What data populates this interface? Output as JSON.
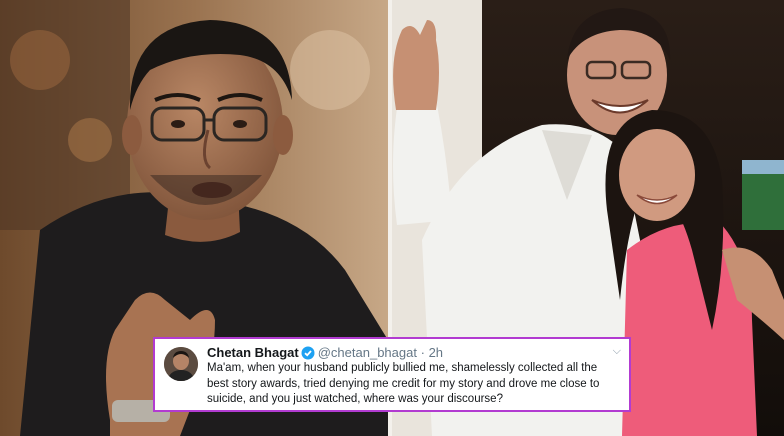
{
  "tweet": {
    "author_name": "Chetan Bhagat",
    "handle": "@chetan_bhagat",
    "separator": "·",
    "time": "2h",
    "text": "Ma'am, when your husband publicly bullied me, shamelessly collected all the best story awards, tried denying me credit for my story and drove me close to suicide, and you just watched, where was your discourse?",
    "border_color": "#b23bd1",
    "verified_badge_color": "#1da1f2"
  },
  "icons": {
    "verified": "verified-badge-icon",
    "menu": "chevron-down-icon"
  }
}
